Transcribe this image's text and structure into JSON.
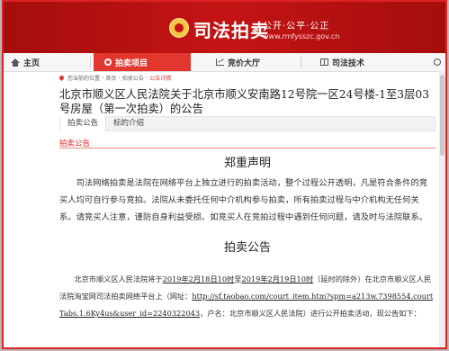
{
  "header": {
    "brand": "司法拍卖",
    "slogan": "公开·公平·公正",
    "site": "www.rmfysszc.gov.cn"
  },
  "nav": {
    "items": [
      {
        "label": "主页",
        "icon": "home-icon"
      },
      {
        "label": "拍卖项目",
        "icon": "auction-icon",
        "active": true
      },
      {
        "label": "竞价大厅",
        "icon": "trend-icon"
      },
      {
        "label": "司法技术",
        "icon": "book-icon"
      }
    ]
  },
  "breadcrumb": [
    "您当前的位置",
    "首页",
    "拍卖公告",
    "公告详情"
  ],
  "page_title": "北京市顺义区人民法院关于北京市顺义安南路12号院一区24号楼-1至3层03号房屋（第一次拍卖）的公告",
  "tabs": [
    "拍卖公告",
    "标的介绍"
  ],
  "section_label": "拍卖公告",
  "statement": {
    "heading": "郑重声明",
    "body": "司法网络拍卖是法院在网络平台上独立进行的拍卖活动，整个过程公开透明，凡是符合条件的竞买人均可自行参与竞拍。法院从未委托任何中介机构参与拍卖，所有拍卖过程与中介机构无任何关系。请竞买人注意，谨防自身利益受损。如竞买人在竞拍过程中遇到任何问题，请及时与法院联系。"
  },
  "notice": {
    "heading": "拍卖公告",
    "p_prefix": "北京市顺义区人民法院将于",
    "start": "2019年2月18日10时",
    "to": "至",
    "end": "2019年2月19日10时",
    "middle": "（延时的除外）在北京市顺义区人民法院淘宝网司法拍卖网络平台上（网址：",
    "url": "http://sf.taobao.com/court_item.htm?spm=a213w.7398554.courtTabs.1.6Ky4us&user_id=2240322043",
    "suffix": "，户名：北京市顺义区人民法院）进行公开拍卖活动，现公告如下："
  },
  "colors": {
    "brand_red": "#c41414",
    "nav_active": "#e1372f",
    "accent_text": "#d22"
  }
}
